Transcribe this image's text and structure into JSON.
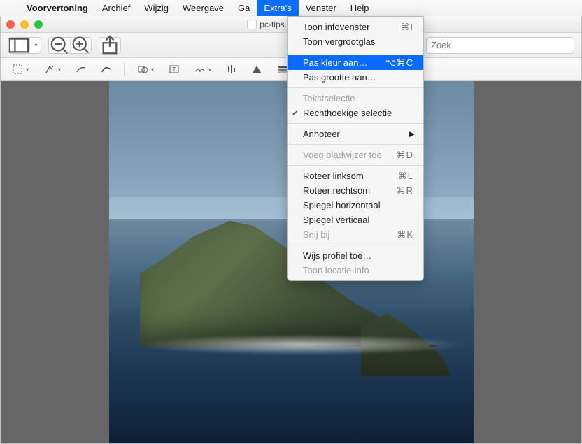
{
  "menubar": {
    "app_name": "Voorvertoning",
    "items": [
      "Archief",
      "Wijzig",
      "Weergave",
      "Ga",
      "Extra's",
      "Venster",
      "Help"
    ],
    "active_index": 4
  },
  "window": {
    "title": "pc-tips.info voorbeel"
  },
  "toolbar": {
    "search_placeholder": "Zoek"
  },
  "dropdown": {
    "groups": [
      [
        {
          "label": "Toon infovenster",
          "shortcut": "⌘I"
        },
        {
          "label": "Toon vergrootglas"
        }
      ],
      [
        {
          "label": "Pas kleur aan…",
          "shortcut": "⌥⌘C",
          "highlight": true
        },
        {
          "label": "Pas grootte aan…"
        }
      ],
      [
        {
          "label": "Tekstselectie",
          "disabled": true
        },
        {
          "label": "Rechthoekige selectie",
          "checked": true
        }
      ],
      [
        {
          "label": "Annoteer",
          "submenu": true
        }
      ],
      [
        {
          "label": "Voeg bladwijzer toe",
          "shortcut": "⌘D",
          "disabled": true
        }
      ],
      [
        {
          "label": "Roteer linksom",
          "shortcut": "⌘L"
        },
        {
          "label": "Roteer rechtsom",
          "shortcut": "⌘R"
        },
        {
          "label": "Spiegel horizontaal"
        },
        {
          "label": "Spiegel verticaal"
        },
        {
          "label": "Snij bij",
          "shortcut": "⌘K",
          "disabled": true
        }
      ],
      [
        {
          "label": "Wijs profiel toe…"
        },
        {
          "label": "Toon locatie-info",
          "disabled": true
        }
      ]
    ]
  }
}
